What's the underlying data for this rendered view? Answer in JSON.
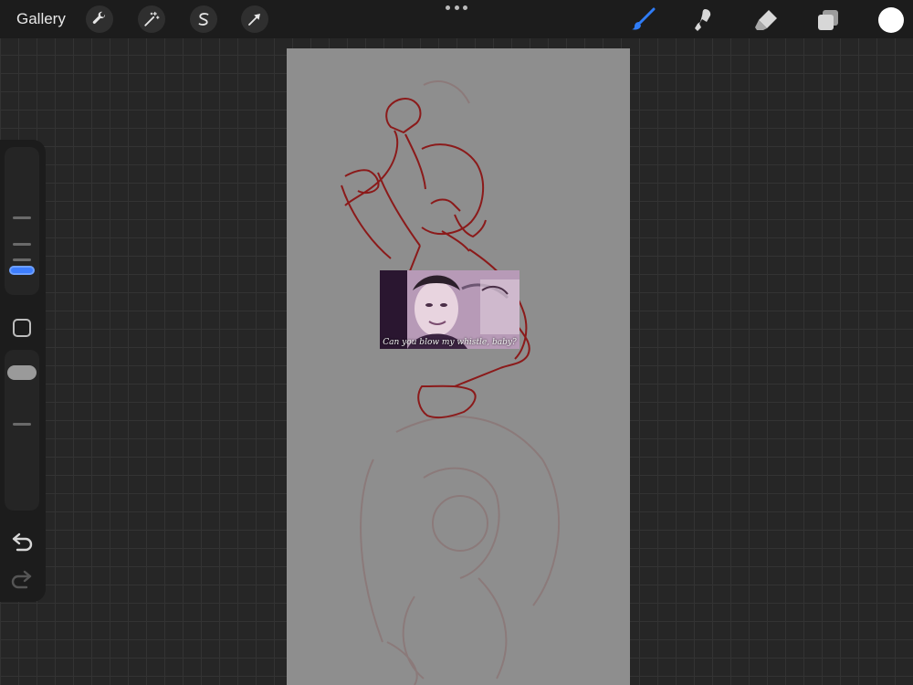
{
  "topbar": {
    "gallery_label": "Gallery",
    "left_tools": [
      "wrench-icon",
      "magic-wand-icon",
      "selection-s-icon",
      "transform-arrow-icon"
    ],
    "right_tools": [
      "brush-icon",
      "smudge-icon",
      "eraser-icon",
      "layers-icon"
    ],
    "active_tool": "brush",
    "accent_color": "#2f7cf6",
    "current_color": "#ffffff"
  },
  "sidebar": {
    "brush_size_level": 0.55,
    "opacity_level": 0.3,
    "undo_icon": "undo-icon",
    "redo_icon": "redo-icon"
  },
  "canvas": {
    "sketch_color": "#8b1a1a",
    "pasted_image_caption": "Can you blow my whistle, baby?"
  }
}
